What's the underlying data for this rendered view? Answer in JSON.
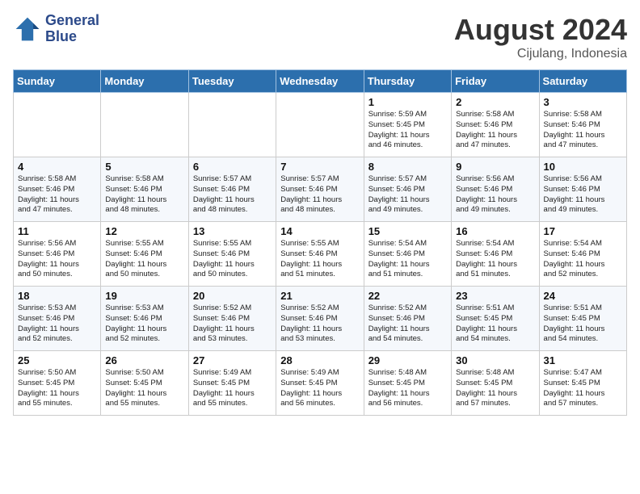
{
  "header": {
    "logo_line1": "General",
    "logo_line2": "Blue",
    "month_year": "August 2024",
    "location": "Cijulang, Indonesia"
  },
  "weekdays": [
    "Sunday",
    "Monday",
    "Tuesday",
    "Wednesday",
    "Thursday",
    "Friday",
    "Saturday"
  ],
  "weeks": [
    [
      {
        "day": "",
        "info": ""
      },
      {
        "day": "",
        "info": ""
      },
      {
        "day": "",
        "info": ""
      },
      {
        "day": "",
        "info": ""
      },
      {
        "day": "1",
        "info": "Sunrise: 5:59 AM\nSunset: 5:45 PM\nDaylight: 11 hours\nand 46 minutes."
      },
      {
        "day": "2",
        "info": "Sunrise: 5:58 AM\nSunset: 5:46 PM\nDaylight: 11 hours\nand 47 minutes."
      },
      {
        "day": "3",
        "info": "Sunrise: 5:58 AM\nSunset: 5:46 PM\nDaylight: 11 hours\nand 47 minutes."
      }
    ],
    [
      {
        "day": "4",
        "info": "Sunrise: 5:58 AM\nSunset: 5:46 PM\nDaylight: 11 hours\nand 47 minutes."
      },
      {
        "day": "5",
        "info": "Sunrise: 5:58 AM\nSunset: 5:46 PM\nDaylight: 11 hours\nand 48 minutes."
      },
      {
        "day": "6",
        "info": "Sunrise: 5:57 AM\nSunset: 5:46 PM\nDaylight: 11 hours\nand 48 minutes."
      },
      {
        "day": "7",
        "info": "Sunrise: 5:57 AM\nSunset: 5:46 PM\nDaylight: 11 hours\nand 48 minutes."
      },
      {
        "day": "8",
        "info": "Sunrise: 5:57 AM\nSunset: 5:46 PM\nDaylight: 11 hours\nand 49 minutes."
      },
      {
        "day": "9",
        "info": "Sunrise: 5:56 AM\nSunset: 5:46 PM\nDaylight: 11 hours\nand 49 minutes."
      },
      {
        "day": "10",
        "info": "Sunrise: 5:56 AM\nSunset: 5:46 PM\nDaylight: 11 hours\nand 49 minutes."
      }
    ],
    [
      {
        "day": "11",
        "info": "Sunrise: 5:56 AM\nSunset: 5:46 PM\nDaylight: 11 hours\nand 50 minutes."
      },
      {
        "day": "12",
        "info": "Sunrise: 5:55 AM\nSunset: 5:46 PM\nDaylight: 11 hours\nand 50 minutes."
      },
      {
        "day": "13",
        "info": "Sunrise: 5:55 AM\nSunset: 5:46 PM\nDaylight: 11 hours\nand 50 minutes."
      },
      {
        "day": "14",
        "info": "Sunrise: 5:55 AM\nSunset: 5:46 PM\nDaylight: 11 hours\nand 51 minutes."
      },
      {
        "day": "15",
        "info": "Sunrise: 5:54 AM\nSunset: 5:46 PM\nDaylight: 11 hours\nand 51 minutes."
      },
      {
        "day": "16",
        "info": "Sunrise: 5:54 AM\nSunset: 5:46 PM\nDaylight: 11 hours\nand 51 minutes."
      },
      {
        "day": "17",
        "info": "Sunrise: 5:54 AM\nSunset: 5:46 PM\nDaylight: 11 hours\nand 52 minutes."
      }
    ],
    [
      {
        "day": "18",
        "info": "Sunrise: 5:53 AM\nSunset: 5:46 PM\nDaylight: 11 hours\nand 52 minutes."
      },
      {
        "day": "19",
        "info": "Sunrise: 5:53 AM\nSunset: 5:46 PM\nDaylight: 11 hours\nand 52 minutes."
      },
      {
        "day": "20",
        "info": "Sunrise: 5:52 AM\nSunset: 5:46 PM\nDaylight: 11 hours\nand 53 minutes."
      },
      {
        "day": "21",
        "info": "Sunrise: 5:52 AM\nSunset: 5:46 PM\nDaylight: 11 hours\nand 53 minutes."
      },
      {
        "day": "22",
        "info": "Sunrise: 5:52 AM\nSunset: 5:46 PM\nDaylight: 11 hours\nand 54 minutes."
      },
      {
        "day": "23",
        "info": "Sunrise: 5:51 AM\nSunset: 5:45 PM\nDaylight: 11 hours\nand 54 minutes."
      },
      {
        "day": "24",
        "info": "Sunrise: 5:51 AM\nSunset: 5:45 PM\nDaylight: 11 hours\nand 54 minutes."
      }
    ],
    [
      {
        "day": "25",
        "info": "Sunrise: 5:50 AM\nSunset: 5:45 PM\nDaylight: 11 hours\nand 55 minutes."
      },
      {
        "day": "26",
        "info": "Sunrise: 5:50 AM\nSunset: 5:45 PM\nDaylight: 11 hours\nand 55 minutes."
      },
      {
        "day": "27",
        "info": "Sunrise: 5:49 AM\nSunset: 5:45 PM\nDaylight: 11 hours\nand 55 minutes."
      },
      {
        "day": "28",
        "info": "Sunrise: 5:49 AM\nSunset: 5:45 PM\nDaylight: 11 hours\nand 56 minutes."
      },
      {
        "day": "29",
        "info": "Sunrise: 5:48 AM\nSunset: 5:45 PM\nDaylight: 11 hours\nand 56 minutes."
      },
      {
        "day": "30",
        "info": "Sunrise: 5:48 AM\nSunset: 5:45 PM\nDaylight: 11 hours\nand 57 minutes."
      },
      {
        "day": "31",
        "info": "Sunrise: 5:47 AM\nSunset: 5:45 PM\nDaylight: 11 hours\nand 57 minutes."
      }
    ]
  ]
}
